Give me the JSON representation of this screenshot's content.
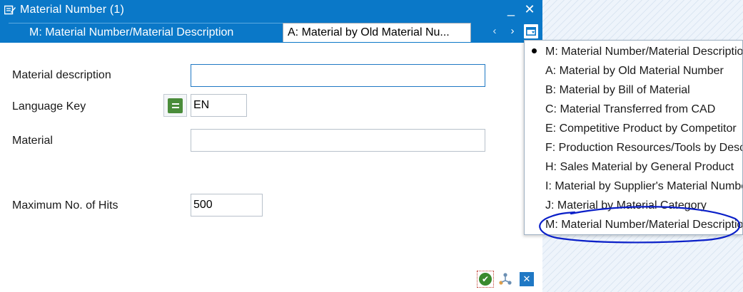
{
  "window": {
    "title": "Material Number (1)",
    "minimize_glyph": "_",
    "close_glyph": "✕",
    "title_icon": "edit-form-icon"
  },
  "tabs": {
    "active_label": "M: Material Number/Material Description",
    "inactive_label": "A: Material by Old Material Nu...",
    "prev_glyph": "‹",
    "next_glyph": "›"
  },
  "form": {
    "material_description_label": "Material description",
    "material_description_value": "",
    "language_key_label": "Language Key",
    "language_key_value": "EN",
    "material_label": "Material",
    "material_value": "",
    "max_hits_label": "Maximum No. of Hits",
    "max_hits_value": "500"
  },
  "dropdown": {
    "items": [
      "M: Material Number/Material Description",
      "A: Material by Old Material Number",
      "B: Material by Bill of Material",
      "C: Material Transferred from CAD",
      "E: Competitive Product by Competitor",
      "F: Production Resources/Tools by Description",
      "H: Sales Material by General Product",
      "I: Material by Supplier's Material Number",
      "J: Material by Material Category",
      "M: Material Number/Material Description"
    ]
  },
  "colors": {
    "header_blue": "#0a78c8",
    "annotation_ink": "#0a1fc8",
    "confirm_green": "#3a8a2e"
  }
}
